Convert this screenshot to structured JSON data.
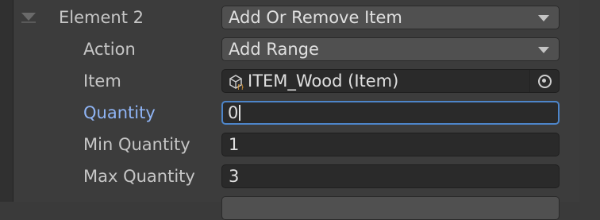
{
  "element": {
    "label": "Element 2",
    "value": "Add Or Remove Item"
  },
  "action": {
    "label": "Action",
    "value": "Add Range"
  },
  "item": {
    "label": "Item",
    "value": "ITEM_Wood (Item)",
    "icon": "scriptable-object-icon"
  },
  "quantity": {
    "label": "Quantity",
    "value": "0"
  },
  "min_quantity": {
    "label": "Min Quantity",
    "value": "1"
  },
  "max_quantity": {
    "label": "Max Quantity",
    "value": "3"
  },
  "colors": {
    "focus_label": "#8fb4f5",
    "focus_border": "#4d85c9",
    "panel_bg": "#3c3c3c",
    "field_bg": "#2a2a2a"
  }
}
